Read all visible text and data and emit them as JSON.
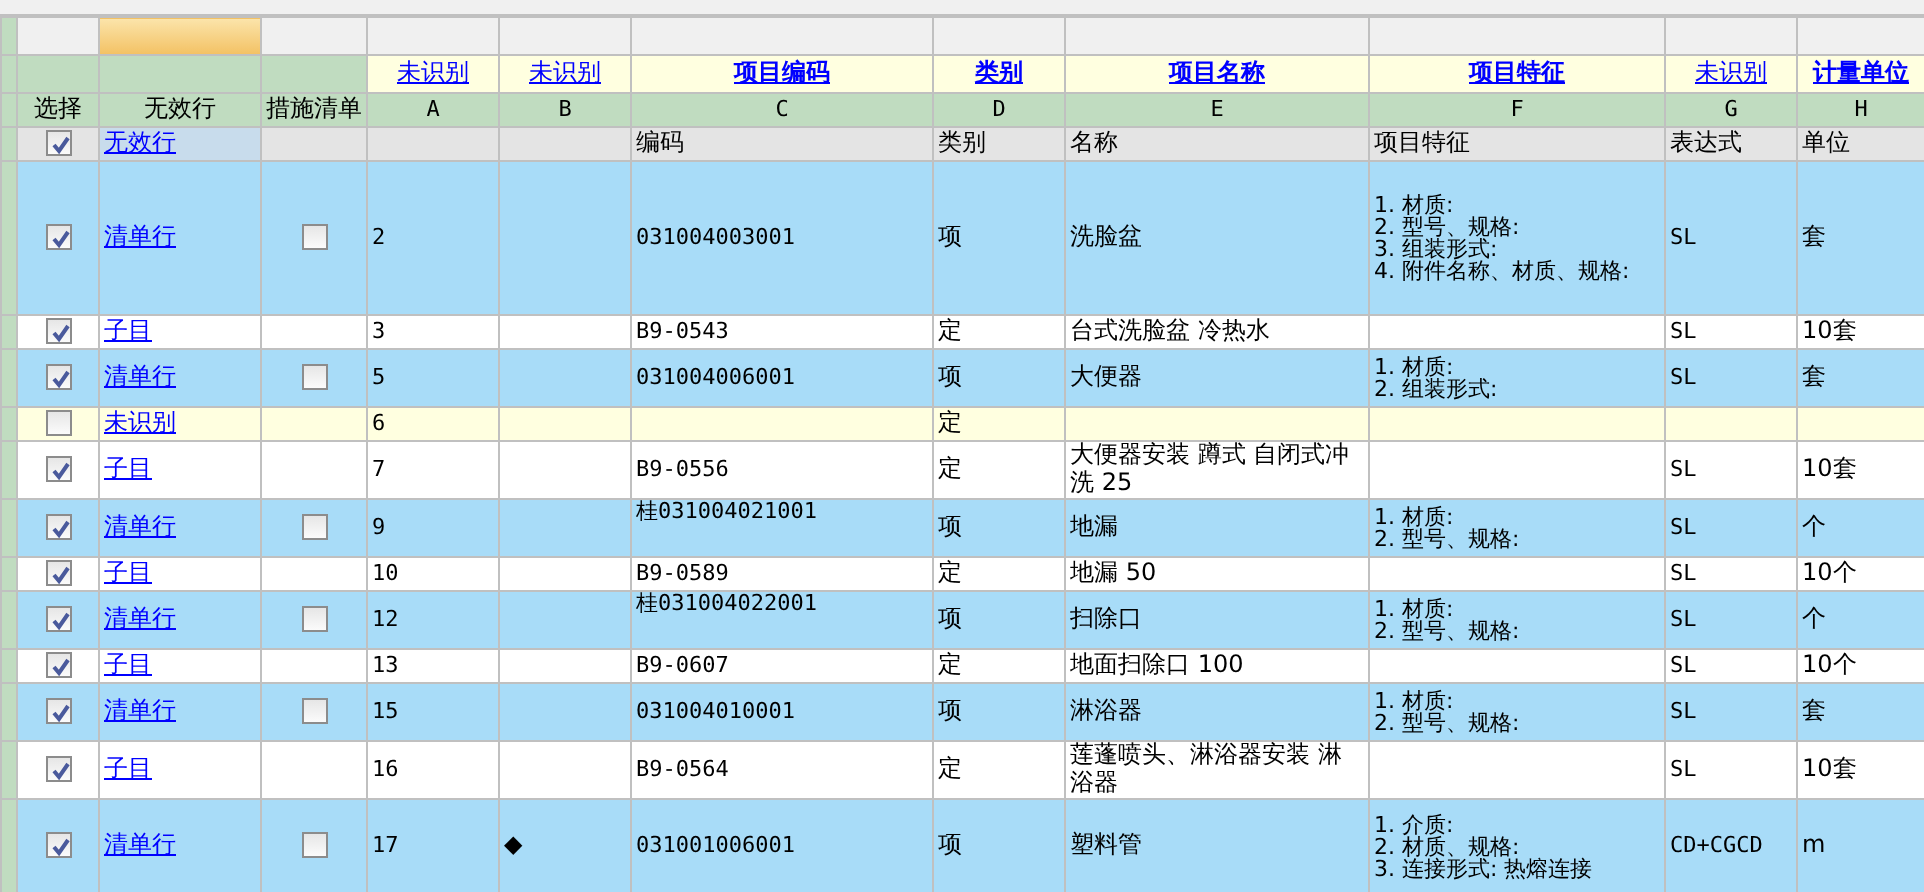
{
  "fixed_columns": [
    {
      "label": "选择",
      "selected": false
    },
    {
      "label": "无效行",
      "selected": true
    },
    {
      "label": "措施清单",
      "selected": false
    }
  ],
  "columns": [
    {
      "field_label": "未识别",
      "bold": false,
      "letter": "A"
    },
    {
      "field_label": "未识别",
      "bold": false,
      "letter": "B"
    },
    {
      "field_label": "项目编码",
      "bold": true,
      "letter": "C"
    },
    {
      "field_label": "类别",
      "bold": true,
      "letter": "D"
    },
    {
      "field_label": "项目名称",
      "bold": true,
      "letter": "E"
    },
    {
      "field_label": "项目特征",
      "bold": true,
      "letter": "F"
    },
    {
      "field_label": "未识别",
      "bold": false,
      "letter": "G"
    },
    {
      "field_label": "计量单位",
      "bold": true,
      "letter": "H"
    }
  ],
  "title_row": {
    "checked": true,
    "type_label": "无效行",
    "selected": true,
    "code": "编码",
    "category": "类别",
    "name": "名称",
    "features": [
      "项目特征"
    ],
    "expression": "表达式",
    "unit": "单位"
  },
  "rows": [
    {
      "kind": "list",
      "checked": true,
      "type_label": "清单行",
      "measure_checked": false,
      "number": "2",
      "code": "031004003001",
      "category": "项",
      "name": "洗脸盆",
      "features": [
        "1. 材质:",
        "2. 型号、规格:",
        "3. 组装形式:",
        "4. 附件名称、材质、规格:"
      ],
      "expression": "SL",
      "unit": "套"
    },
    {
      "kind": "sub",
      "checked": true,
      "type_label": "子目",
      "number": "3",
      "code": "B9-0543",
      "category": "定",
      "name": "台式洗脸盆 冷热水",
      "expression": "SL",
      "unit": "10套"
    },
    {
      "kind": "list",
      "checked": true,
      "type_label": "清单行",
      "measure_checked": false,
      "number": "5",
      "code": "031004006001",
      "category": "项",
      "name": "大便器",
      "features": [
        "1. 材质:",
        "2. 组装形式:"
      ],
      "expression": "SL",
      "unit": "套"
    },
    {
      "kind": "unknown",
      "checked": false,
      "type_label": "未识别",
      "number": "6",
      "category": "定"
    },
    {
      "kind": "sub",
      "checked": true,
      "type_label": "子目",
      "number": "7",
      "code": "B9-0556",
      "category": "定",
      "name": "大便器安装 蹲式 自闭式冲洗 25",
      "expression": "SL",
      "unit": "10套"
    },
    {
      "kind": "list",
      "checked": true,
      "type_label": "清单行",
      "measure_checked": false,
      "number": "9",
      "code": "桂031004021001",
      "category": "项",
      "name": "地漏",
      "features": [
        "1. 材质:",
        "2. 型号、规格:"
      ],
      "expression": "SL",
      "unit": "个"
    },
    {
      "kind": "sub",
      "checked": true,
      "type_label": "子目",
      "number": "10",
      "code": "B9-0589",
      "category": "定",
      "name": "地漏 50",
      "expression": "SL",
      "unit": "10个"
    },
    {
      "kind": "list",
      "checked": true,
      "type_label": "清单行",
      "measure_checked": false,
      "number": "12",
      "code": "桂031004022001",
      "category": "项",
      "name": "扫除口",
      "features": [
        "1. 材质:",
        "2. 型号、规格:"
      ],
      "expression": "SL",
      "unit": "个"
    },
    {
      "kind": "sub",
      "checked": true,
      "type_label": "子目",
      "number": "13",
      "code": "B9-0607",
      "category": "定",
      "name": "地面扫除口 100",
      "expression": "SL",
      "unit": "10个"
    },
    {
      "kind": "list",
      "checked": true,
      "type_label": "清单行",
      "measure_checked": false,
      "number": "15",
      "code": "031004010001",
      "category": "项",
      "name": "淋浴器",
      "features": [
        "1. 材质:",
        "2. 型号、规格:"
      ],
      "expression": "SL",
      "unit": "套"
    },
    {
      "kind": "sub",
      "checked": true,
      "type_label": "子目",
      "number": "16",
      "code": "B9-0564",
      "category": "定",
      "name": "莲蓬喷头、淋浴器安装 淋浴器",
      "expression": "SL",
      "unit": "10套"
    },
    {
      "kind": "list",
      "checked": true,
      "type_label": "清单行",
      "measure_checked": false,
      "number": "17",
      "mark": "◆",
      "code": "031001006001",
      "category": "项",
      "name": "塑料管",
      "features": [
        "1. 介质:",
        "2. 材质、规格:",
        "3. 连接形式: 热熔连接"
      ],
      "expression": "CD+CGCD",
      "unit": "m"
    }
  ]
}
